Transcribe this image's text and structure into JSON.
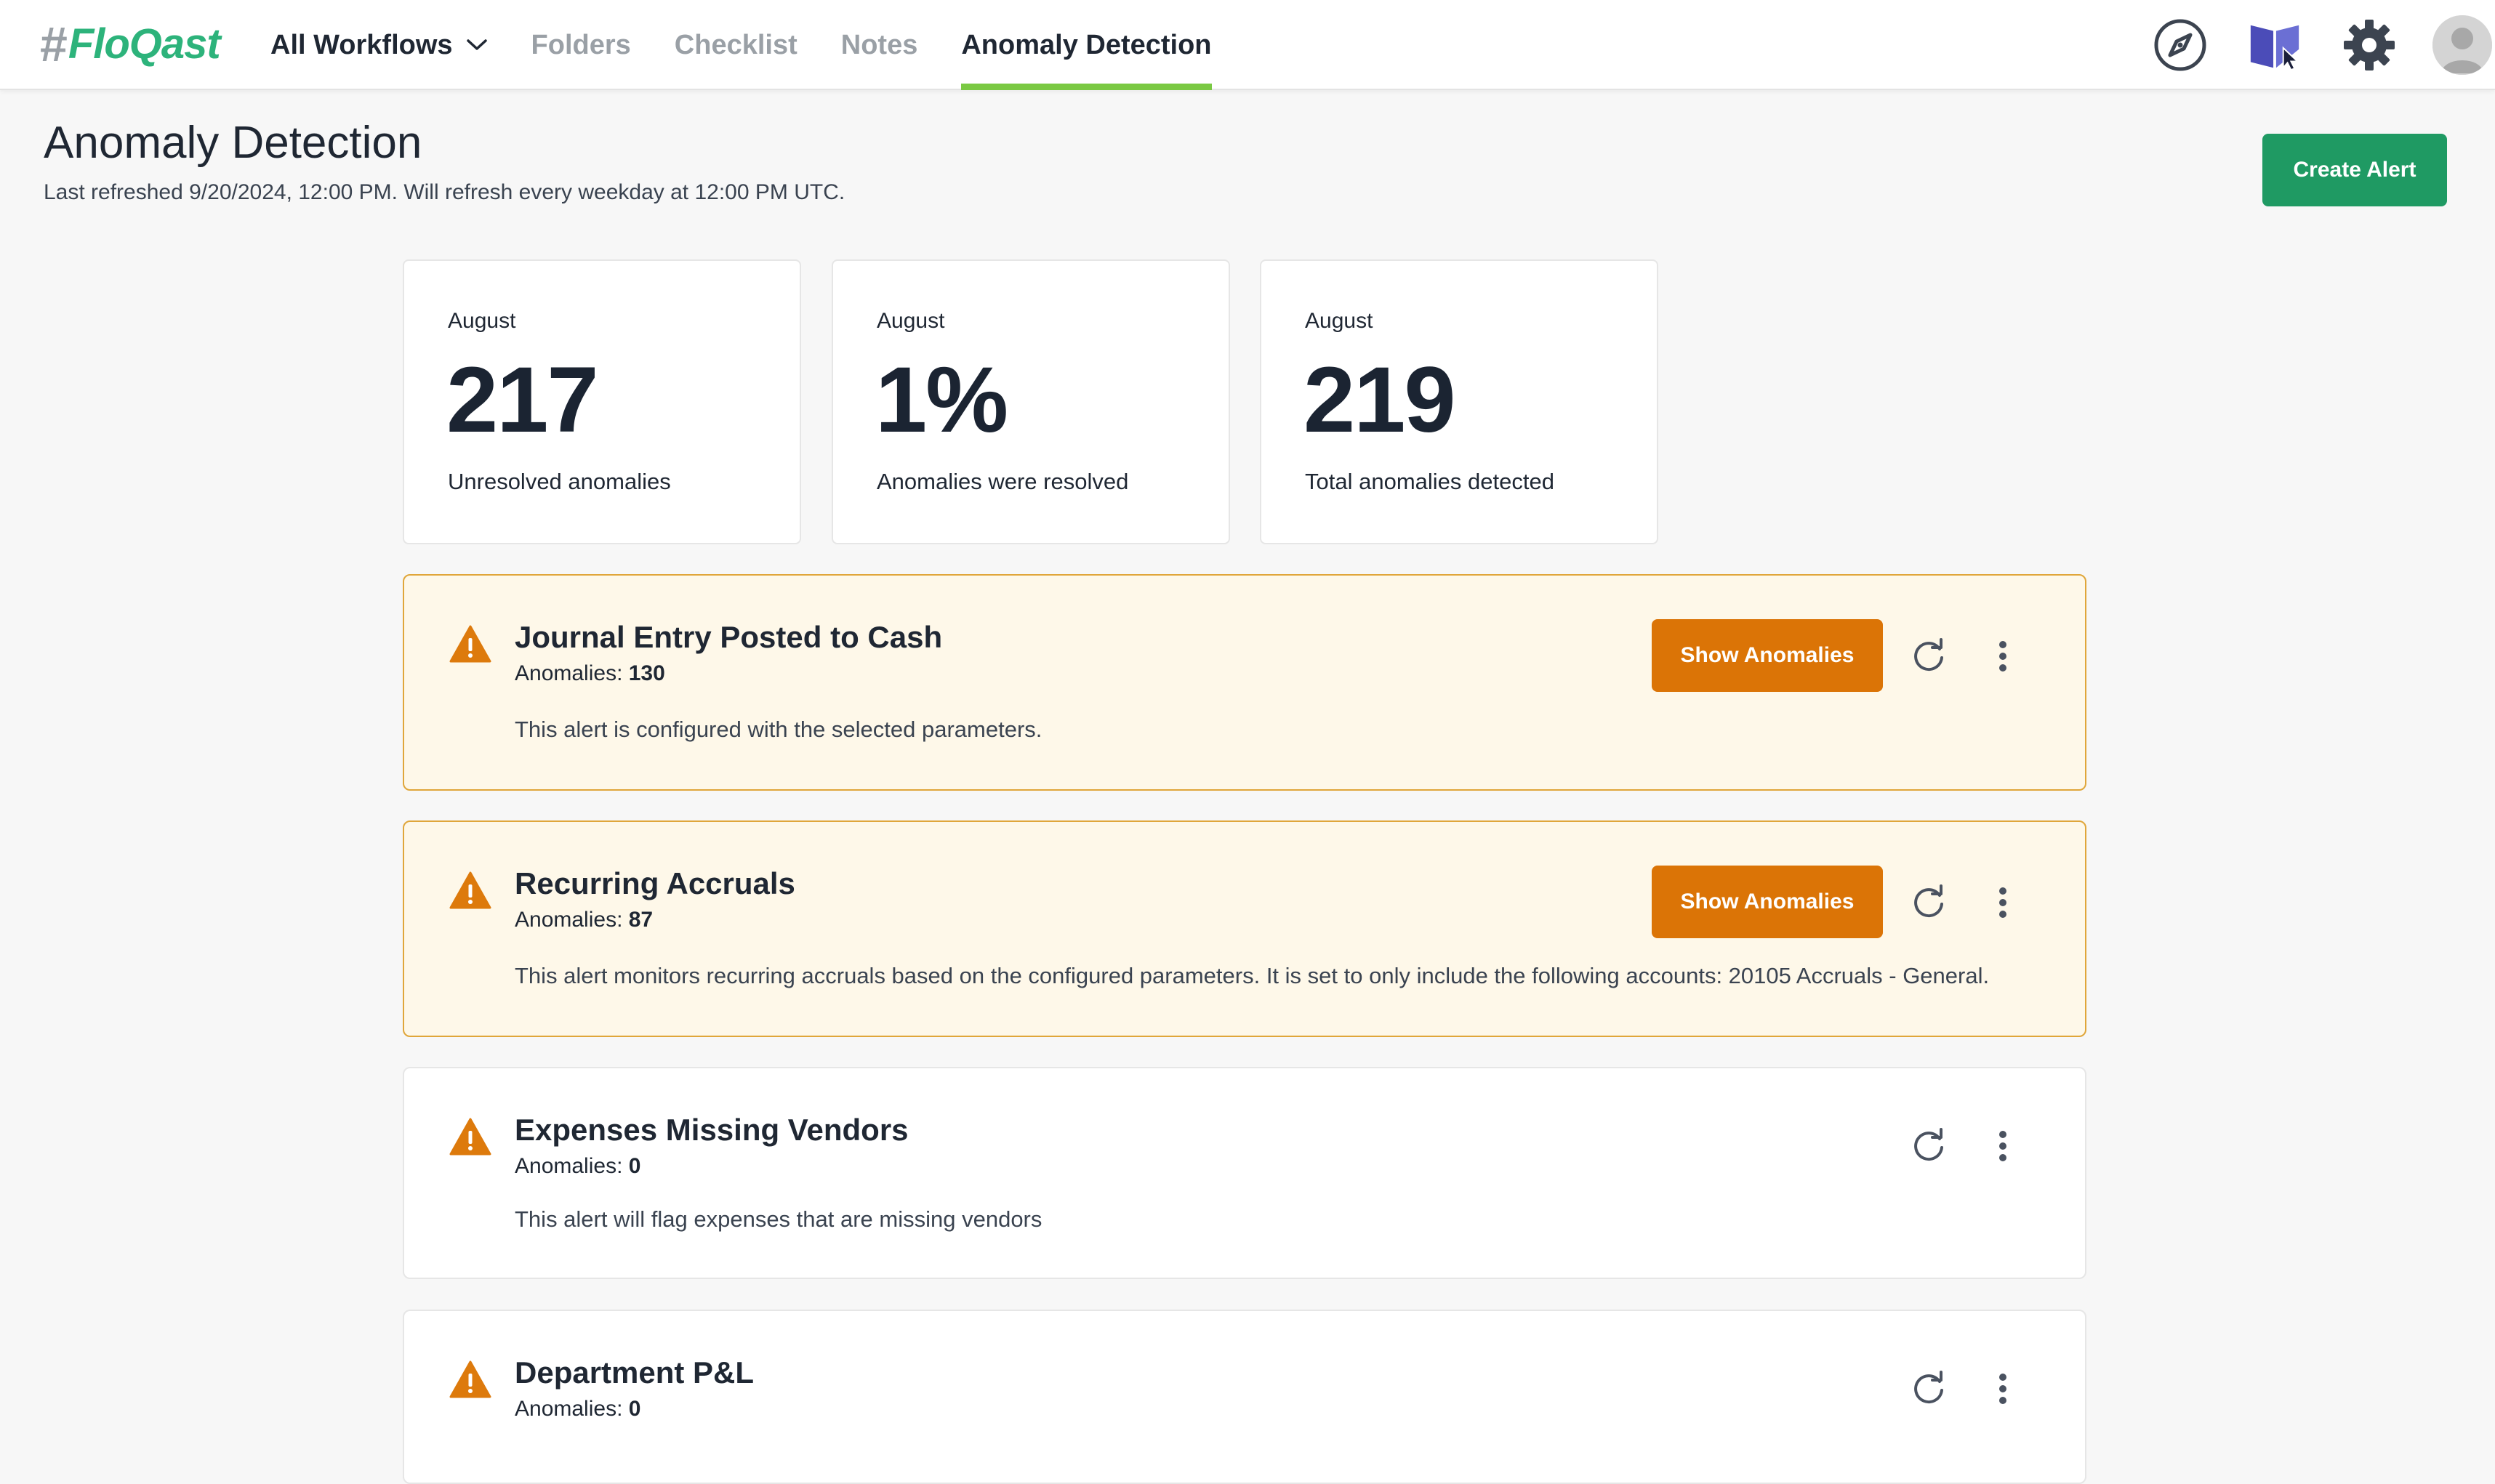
{
  "brand": {
    "hash": "#",
    "name": "FloQast"
  },
  "nav": {
    "workflows": "All Workflows",
    "folders": "Folders",
    "checklist": "Checklist",
    "notes": "Notes",
    "anomaly": "Anomaly Detection"
  },
  "header": {
    "title": "Anomaly Detection",
    "refresh_note": "Last refreshed 9/20/2024, 12:00 PM. Will refresh every weekday at 12:00 PM UTC.",
    "create_label": "Create Alert"
  },
  "stats": [
    {
      "month": "August",
      "value": "217",
      "label": "Unresolved anomalies"
    },
    {
      "month": "August",
      "value": "1%",
      "label": "Anomalies were resolved"
    },
    {
      "month": "August",
      "value": "219",
      "label": "Total anomalies detected"
    }
  ],
  "alerts": [
    {
      "title": "Journal Entry Posted to Cash",
      "count_label": "Anomalies:",
      "count": "130",
      "description": "This alert is configured with the selected parameters.",
      "action_label": "Show Anomalies"
    },
    {
      "title": "Recurring Accruals",
      "count_label": "Anomalies:",
      "count": "87",
      "description": "This alert monitors recurring accruals based on the configured parameters. It is set to only include the following accounts: 20105 Accruals - General.",
      "action_label": "Show Anomalies"
    },
    {
      "title": "Expenses Missing Vendors",
      "count_label": "Anomalies:",
      "count": "0",
      "description": "This alert will flag expenses that are missing vendors"
    },
    {
      "title": "Department P&L",
      "count_label": "Anomalies:",
      "count": "0"
    }
  ],
  "colors": {
    "accent_green": "#1f9a63",
    "nav_active_underline": "#7ac943",
    "warning_orange": "#db7406",
    "warning_bg": "#fef8e9",
    "warning_border": "#e0a63a"
  },
  "icons": {
    "explore": "compass-icon",
    "learning": "book-cursor-icon",
    "settings": "gear-icon",
    "user": "avatar-icon",
    "alert": "warning-triangle-icon",
    "refresh": "refresh-icon",
    "more": "kebab-icon"
  }
}
